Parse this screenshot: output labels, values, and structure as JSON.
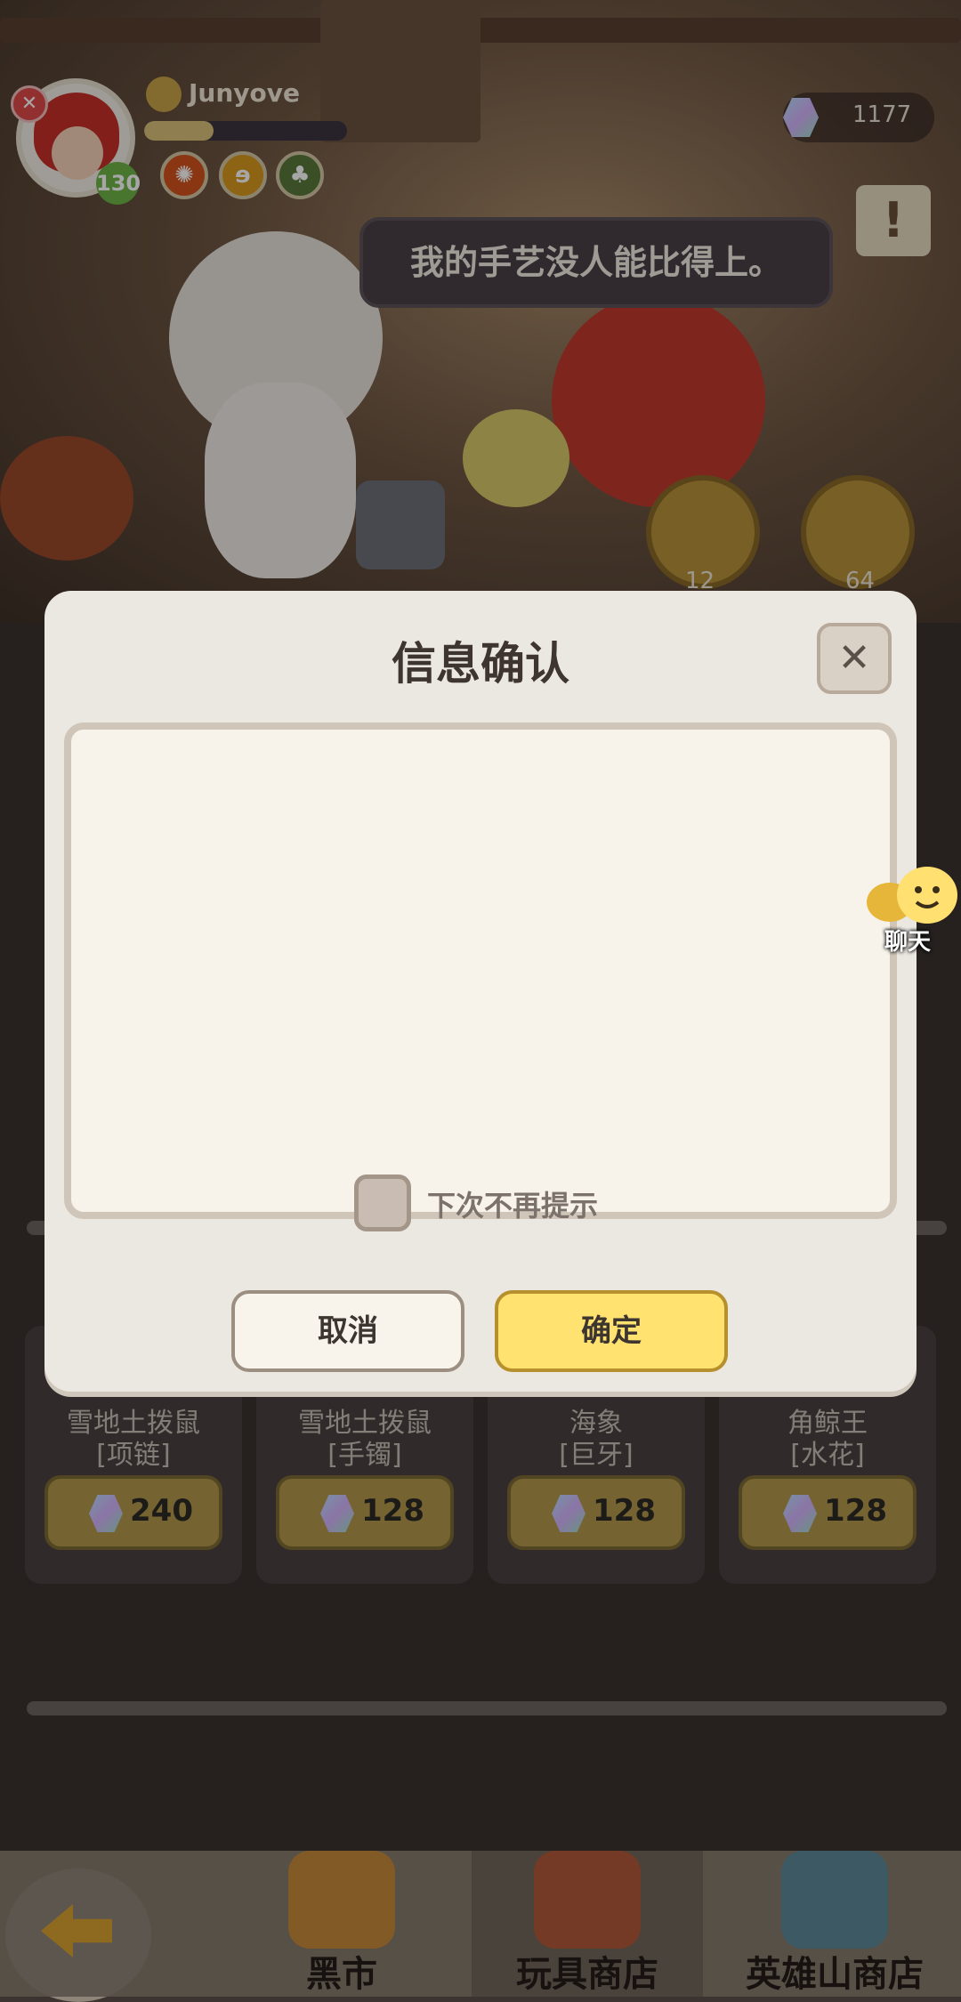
{
  "header": {
    "username": "Junyove",
    "level": "130",
    "xp_fraction": 0.34,
    "gem_count": "1177",
    "rank_badge_icon": "crossed-swords-icon"
  },
  "npc": {
    "speech": "我的手艺没人能比得上。"
  },
  "refresh": [
    {
      "count": "12"
    },
    {
      "count": "64"
    }
  ],
  "shop_items": [
    {
      "name": "雪地土拨鼠",
      "sub": "[项链]",
      "price": "240",
      "color": "#8b4fa0"
    },
    {
      "name": "雪地土拨鼠",
      "sub": "[手镯]",
      "price": "128",
      "color": "#2f6a8c"
    },
    {
      "name": "海象",
      "sub": "[巨牙]",
      "price": "128",
      "color": "#2f6a8c"
    },
    {
      "name": "角鲸王",
      "sub": "[水花]",
      "price": "128",
      "color": "#2f6a8c"
    }
  ],
  "dialog": {
    "title": "信息确认",
    "close_glyph": "✕",
    "checkbox_label": "下次不再提示",
    "cancel_label": "取消",
    "confirm_label": "确定"
  },
  "chat": {
    "label": "聊天"
  },
  "tabs": [
    {
      "label": "黑市"
    },
    {
      "label": "玩具商店"
    },
    {
      "label": "英雄山商店"
    }
  ],
  "colors": {
    "confirm_button": "#ffe26f",
    "cancel_button": "#f8f4ec",
    "level_badge": "#6fb548"
  }
}
